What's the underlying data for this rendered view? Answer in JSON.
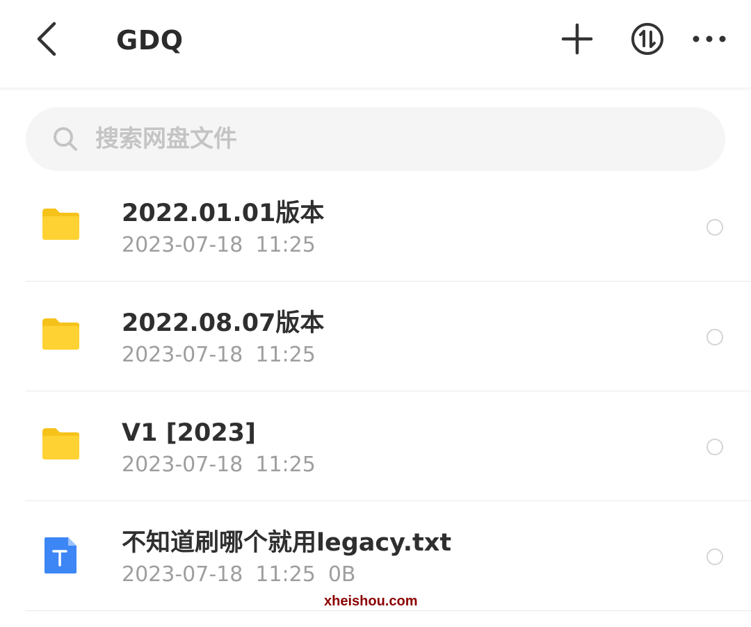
{
  "header": {
    "title": "GDQ",
    "icons": {
      "back": "chevron-left-icon",
      "add": "plus-icon",
      "sort": "sort-updown-icon",
      "more": "more-dots-icon"
    }
  },
  "search": {
    "placeholder": "搜索网盘文件",
    "value": ""
  },
  "files": [
    {
      "type": "folder",
      "name": "2022.01.01版本",
      "date": "2023-07-18",
      "time": "11:25",
      "size": ""
    },
    {
      "type": "folder",
      "name": "2022.08.07版本",
      "date": "2023-07-18",
      "time": "11:25",
      "size": ""
    },
    {
      "type": "folder",
      "name": "V1 [2023]",
      "date": "2023-07-18",
      "time": "11:25",
      "size": ""
    },
    {
      "type": "text-file",
      "name": "不知道刷哪个就用legacy.txt",
      "date": "2023-07-18",
      "time": "11:25",
      "size": "0B"
    }
  ],
  "watermark": "xheishou.com",
  "colors": {
    "folder": "#FFD233",
    "folder_tab": "#F5C21A",
    "doc": "#3D86F5",
    "watermark": "#8B0000"
  }
}
